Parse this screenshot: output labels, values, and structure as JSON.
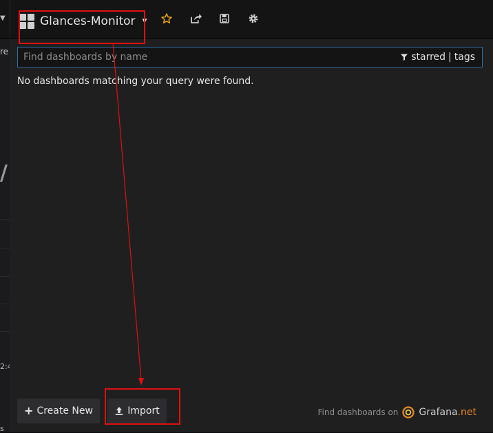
{
  "navbar": {
    "dashboard_title": "Glances-Monitor",
    "icons": [
      "star-icon",
      "share-icon",
      "save-icon",
      "gear-icon"
    ]
  },
  "background_fragments": {
    "top": "re",
    "big": "/",
    "mid": "2:4",
    "bottom": "s"
  },
  "search": {
    "placeholder": "Find dashboards by name",
    "value": "",
    "starred_label": "starred",
    "separator": "|",
    "tags_label": "tags"
  },
  "results": {
    "empty_message": "No dashboards matching your query were found."
  },
  "footer": {
    "create_new_label": "Create New",
    "import_label": "Import",
    "find_text": "Find dashboards on",
    "grafana_word": "Grafana",
    "grafana_tld": ".net"
  },
  "colors": {
    "accent_orange": "#e88a1f",
    "annotation_red": "#e01010",
    "search_border": "#2f6ea8"
  }
}
